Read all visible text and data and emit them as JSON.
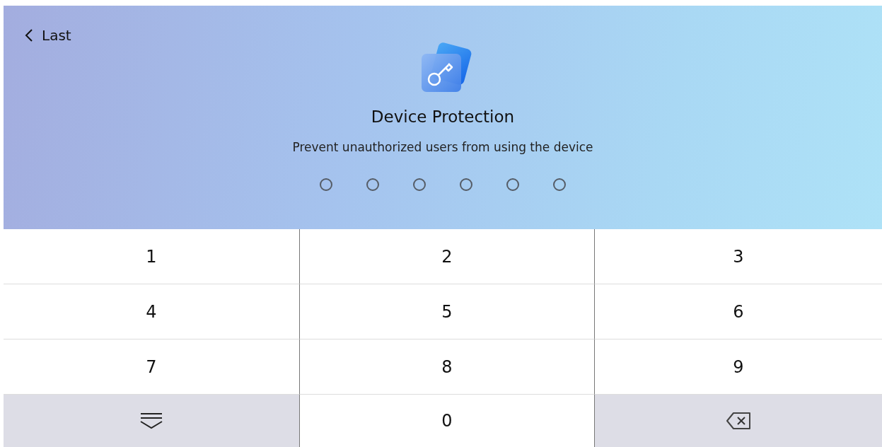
{
  "back": {
    "label": "Last"
  },
  "title": "Device Protection",
  "subtitle": "Prevent unauthorized users from using the device",
  "pin_dots": [
    {
      "filled": false
    },
    {
      "filled": false
    },
    {
      "filled": false
    },
    {
      "filled": false
    },
    {
      "filled": false
    },
    {
      "filled": false
    }
  ],
  "keys": [
    {
      "kind": "digit",
      "label": "1"
    },
    {
      "kind": "digit",
      "label": "2"
    },
    {
      "kind": "digit",
      "label": "3"
    },
    {
      "kind": "digit",
      "label": "4"
    },
    {
      "kind": "digit",
      "label": "5"
    },
    {
      "kind": "digit",
      "label": "6"
    },
    {
      "kind": "digit",
      "label": "7"
    },
    {
      "kind": "digit",
      "label": "8"
    },
    {
      "kind": "digit",
      "label": "9"
    },
    {
      "kind": "hide"
    },
    {
      "kind": "digit",
      "label": "0"
    },
    {
      "kind": "backspace"
    }
  ]
}
